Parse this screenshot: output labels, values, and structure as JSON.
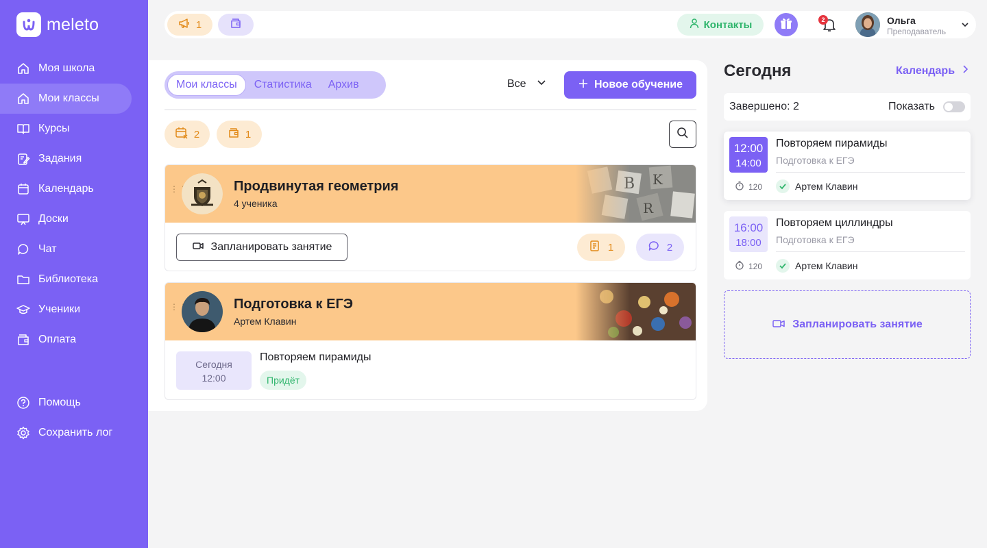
{
  "brand": {
    "name": "meleto",
    "mark": "ⓦ"
  },
  "sidebar": {
    "items": [
      {
        "label": "Моя школа",
        "icon": "home-icon"
      },
      {
        "label": "Мои классы",
        "icon": "home-icon",
        "active": true
      },
      {
        "label": "Курсы",
        "icon": "book-icon"
      },
      {
        "label": "Задания",
        "icon": "edit-icon"
      },
      {
        "label": "Календарь",
        "icon": "calendar-icon"
      },
      {
        "label": "Доски",
        "icon": "board-icon"
      },
      {
        "label": "Чат",
        "icon": "chat-icon"
      },
      {
        "label": "Библиотека",
        "icon": "folder-icon"
      },
      {
        "label": "Ученики",
        "icon": "graduation-cap-icon"
      },
      {
        "label": "Оплата",
        "icon": "wallet-icon"
      }
    ],
    "bottom": [
      {
        "label": "Помощь",
        "icon": "help-icon"
      },
      {
        "label": "Сохранить лог",
        "icon": "gear-icon"
      }
    ]
  },
  "topbar": {
    "announce_count": "1",
    "contacts_label": "Контакты",
    "notifications_count": "2",
    "user": {
      "name": "Ольга",
      "role": "Преподаватель"
    }
  },
  "main": {
    "tabs": [
      {
        "label": "Мои классы",
        "active": true
      },
      {
        "label": "Статистика"
      },
      {
        "label": "Архив"
      }
    ],
    "filter_label": "Все",
    "new_button": "Новое обучение",
    "chips": {
      "calendar_count": "2",
      "wallet_count": "1"
    },
    "classes": [
      {
        "title": "Продвинутая геометрия",
        "subtitle": "4 ученика",
        "plan_label": "Запланировать занятие",
        "tasks_count": "1",
        "messages_count": "2"
      },
      {
        "title": "Подготовка к ЕГЭ",
        "subtitle": "Артем Клавин",
        "lesson": {
          "day": "Сегодня",
          "time": "12:00",
          "title": "Повторяем пирамиды",
          "status": "Придёт"
        }
      }
    ]
  },
  "today": {
    "title": "Сегодня",
    "calendar_link": "Календарь",
    "done_label": "Завершено: 2",
    "show_label": "Показать",
    "show_toggle": false,
    "lessons": [
      {
        "start": "12:00",
        "end": "14:00",
        "title": "Повторяем пирамиды",
        "subtitle": "Подготовка к ЕГЭ",
        "duration": "120",
        "student": "Артем Клавин"
      },
      {
        "start": "16:00",
        "end": "18:00",
        "title": "Повторяем циллиндры",
        "subtitle": "Подготовка к ЕГЭ",
        "duration": "120",
        "student": "Артем Клавин"
      }
    ],
    "plan_label": "Запланировать занятие"
  },
  "colors": {
    "accent": "#7b61f4",
    "orange": "#fcc88a",
    "green": "#2fb56c"
  }
}
